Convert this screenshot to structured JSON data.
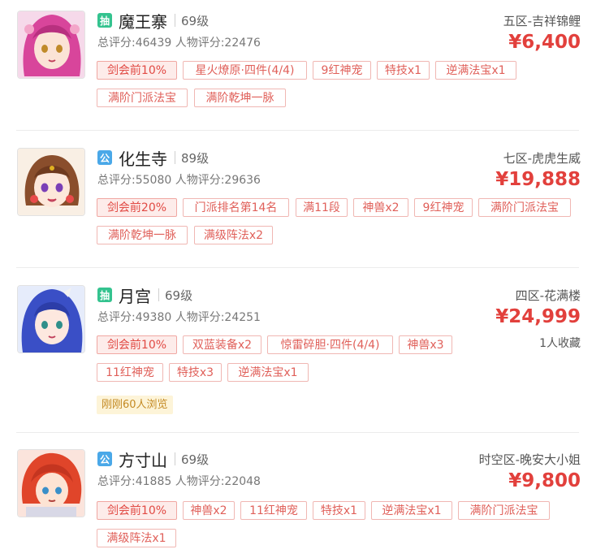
{
  "colors": {
    "price": "#e2403c",
    "tag_border": "#f0b7b3",
    "tag_text": "#e0605a",
    "badge_draw": "#34c38f",
    "badge_public": "#4aa8e8",
    "views_bg": "#fdf4d8"
  },
  "listings": [
    {
      "type_badge": "抽",
      "type_color": "#34c38f",
      "avatar_icon": "pink-haired-character-avatar",
      "school": "魔王寨",
      "level": "69级",
      "scores": "总评分:46439 人物评分:22476",
      "server": "五区-吉祥锦鲤",
      "price": "¥6,400",
      "tags": [
        "剑会前10%",
        "星火燎原·四件(4/4)",
        "9红神宠",
        "特技x1",
        "逆满法宝x1",
        "满阶门派法宝",
        "满阶乾坤一脉"
      ]
    },
    {
      "type_badge": "公",
      "type_color": "#4aa8e8",
      "avatar_icon": "brown-haired-character-avatar",
      "school": "化生寺",
      "level": "89级",
      "scores": "总评分:55080 人物评分:29636",
      "server": "七区-虎虎生威",
      "price": "¥19,888",
      "tags": [
        "剑会前20%",
        "门派排名第14名",
        "满11段",
        "神兽x2",
        "9红神宠",
        "满阶门派法宝",
        "满阶乾坤一脉",
        "满级阵法x2"
      ]
    },
    {
      "type_badge": "抽",
      "type_color": "#34c38f",
      "avatar_icon": "blue-haired-character-avatar",
      "school": "月宫",
      "level": "69级",
      "scores": "总评分:49380 人物评分:24251",
      "server": "四区-花满楼",
      "price": "¥24,999",
      "favorites": "1人收藏",
      "tags": [
        "剑会前10%",
        "双蓝装备x2",
        "惊雷碎胆·四件(4/4)",
        "神兽x3",
        "11红神宠",
        "特技x3",
        "逆满法宝x1"
      ],
      "views": "刚刚60人浏览"
    },
    {
      "type_badge": "公",
      "type_color": "#4aa8e8",
      "avatar_icon": "red-haired-character-avatar",
      "school": "方寸山",
      "level": "69级",
      "scores": "总评分:41885 人物评分:22048",
      "server": "时空区-晚安大小姐",
      "price": "¥9,800",
      "tags": [
        "剑会前10%",
        "神兽x2",
        "11红神宠",
        "特技x1",
        "逆满法宝x1",
        "满阶门派法宝",
        "满级阵法x1"
      ]
    }
  ]
}
